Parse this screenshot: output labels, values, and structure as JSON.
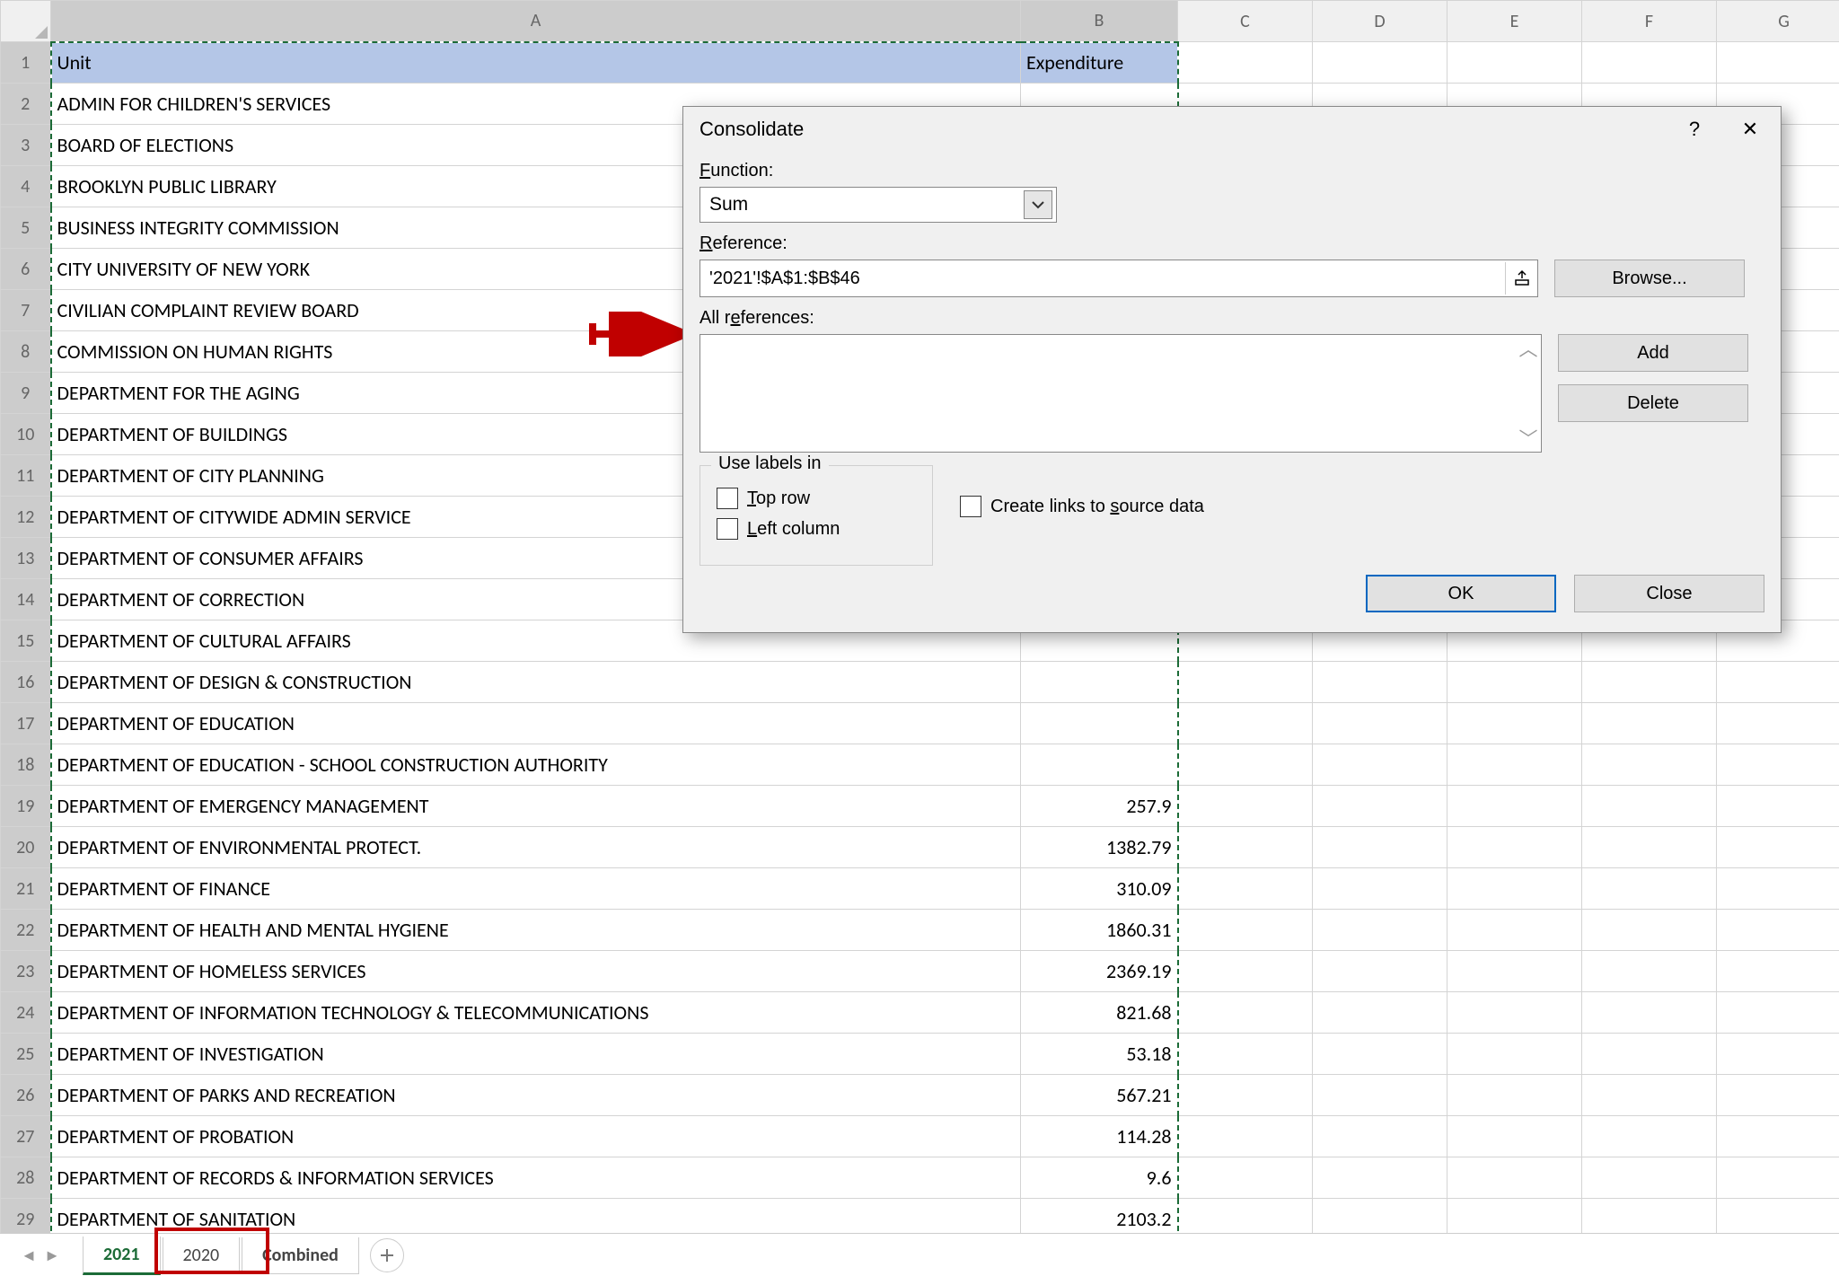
{
  "columns": [
    "A",
    "B",
    "C",
    "D",
    "E",
    "F",
    "G"
  ],
  "header": {
    "unit": "Unit",
    "exp": "Expenditure"
  },
  "rows": [
    {
      "n": 2,
      "a": "ADMIN FOR CHILDREN'S SERVICES",
      "b": ""
    },
    {
      "n": 3,
      "a": "BOARD OF ELECTIONS",
      "b": ""
    },
    {
      "n": 4,
      "a": "BROOKLYN PUBLIC LIBRARY",
      "b": ""
    },
    {
      "n": 5,
      "a": "BUSINESS INTEGRITY COMMISSION",
      "b": ""
    },
    {
      "n": 6,
      "a": "CITY UNIVERSITY OF NEW YORK",
      "b": ""
    },
    {
      "n": 7,
      "a": "CIVILIAN COMPLAINT REVIEW BOARD",
      "b": ""
    },
    {
      "n": 8,
      "a": "COMMISSION ON HUMAN RIGHTS",
      "b": ""
    },
    {
      "n": 9,
      "a": "DEPARTMENT FOR THE AGING",
      "b": ""
    },
    {
      "n": 10,
      "a": "DEPARTMENT OF BUILDINGS",
      "b": ""
    },
    {
      "n": 11,
      "a": "DEPARTMENT OF CITY PLANNING",
      "b": ""
    },
    {
      "n": 12,
      "a": "DEPARTMENT OF CITYWIDE ADMIN SERVICE",
      "b": ""
    },
    {
      "n": 13,
      "a": "DEPARTMENT OF CONSUMER AFFAIRS",
      "b": ""
    },
    {
      "n": 14,
      "a": "DEPARTMENT OF CORRECTION",
      "b": ""
    },
    {
      "n": 15,
      "a": "DEPARTMENT OF CULTURAL AFFAIRS",
      "b": ""
    },
    {
      "n": 16,
      "a": "DEPARTMENT OF DESIGN & CONSTRUCTION",
      "b": ""
    },
    {
      "n": 17,
      "a": "DEPARTMENT OF EDUCATION",
      "b": ""
    },
    {
      "n": 18,
      "a": "DEPARTMENT OF EDUCATION - SCHOOL CONSTRUCTION AUTHORITY",
      "b": ""
    },
    {
      "n": 19,
      "a": "DEPARTMENT OF EMERGENCY MANAGEMENT",
      "b": "257.9"
    },
    {
      "n": 20,
      "a": "DEPARTMENT OF ENVIRONMENTAL PROTECT.",
      "b": "1382.79"
    },
    {
      "n": 21,
      "a": "DEPARTMENT OF FINANCE",
      "b": "310.09"
    },
    {
      "n": 22,
      "a": "DEPARTMENT OF HEALTH AND MENTAL HYGIENE",
      "b": "1860.31"
    },
    {
      "n": 23,
      "a": "DEPARTMENT OF HOMELESS SERVICES",
      "b": "2369.19"
    },
    {
      "n": 24,
      "a": "DEPARTMENT OF INFORMATION TECHNOLOGY & TELECOMMUNICATIONS",
      "b": "821.68"
    },
    {
      "n": 25,
      "a": "DEPARTMENT OF INVESTIGATION",
      "b": "53.18"
    },
    {
      "n": 26,
      "a": "DEPARTMENT OF PARKS AND RECREATION",
      "b": "567.21"
    },
    {
      "n": 27,
      "a": "DEPARTMENT OF PROBATION",
      "b": "114.28"
    },
    {
      "n": 28,
      "a": "DEPARTMENT OF RECORDS & INFORMATION SERVICES",
      "b": "9.6"
    },
    {
      "n": 29,
      "a": "DEPARTMENT OF SANITATION",
      "b": "2103.2"
    }
  ],
  "dialog": {
    "title": "Consolidate",
    "function_label": "Function:",
    "function_value": "Sum",
    "reference_label": "Reference:",
    "reference_value": "'2021'!$A$1:$B$46",
    "allrefs_label": "All references:",
    "browse": "Browse...",
    "add": "Add",
    "delete": "Delete",
    "group_title": "Use labels in",
    "top_row": "Top row",
    "left_col": "Left column",
    "links": "Create links to source data",
    "ok": "OK",
    "close": "Close",
    "help": "?",
    "x": "✕"
  },
  "tabs": {
    "t1": "2021",
    "t2": "2020",
    "t3": "Combined"
  }
}
